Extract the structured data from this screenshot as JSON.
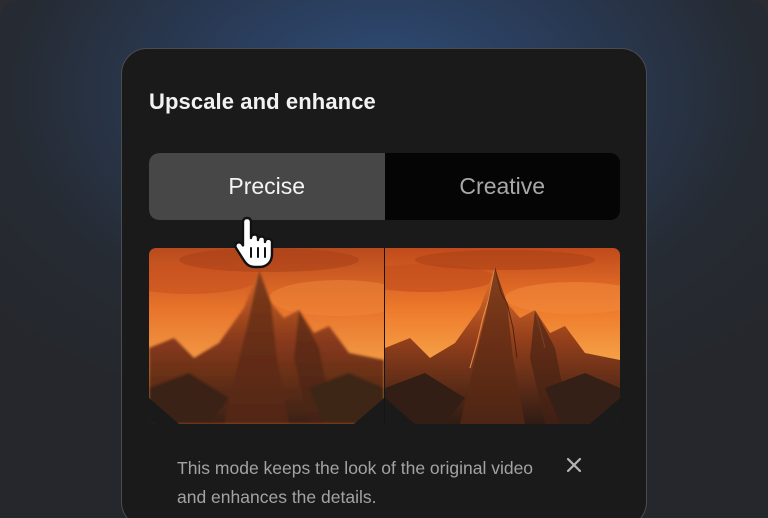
{
  "dialog": {
    "title": "Upscale and enhance",
    "modes": [
      {
        "label": "Precise",
        "selected": true
      },
      {
        "label": "Creative",
        "selected": false
      }
    ],
    "description": "This mode keeps the look of the original video and enhances the details."
  },
  "icons": {
    "cursor": "pointing-hand-cursor",
    "close": "close-icon"
  },
  "colors": {
    "panel_background": "#1a1a1a",
    "segment_active": "#474747",
    "segment_inactive": "#050505",
    "title_text": "#f2f2f2",
    "body_text": "#a3a3a3"
  }
}
